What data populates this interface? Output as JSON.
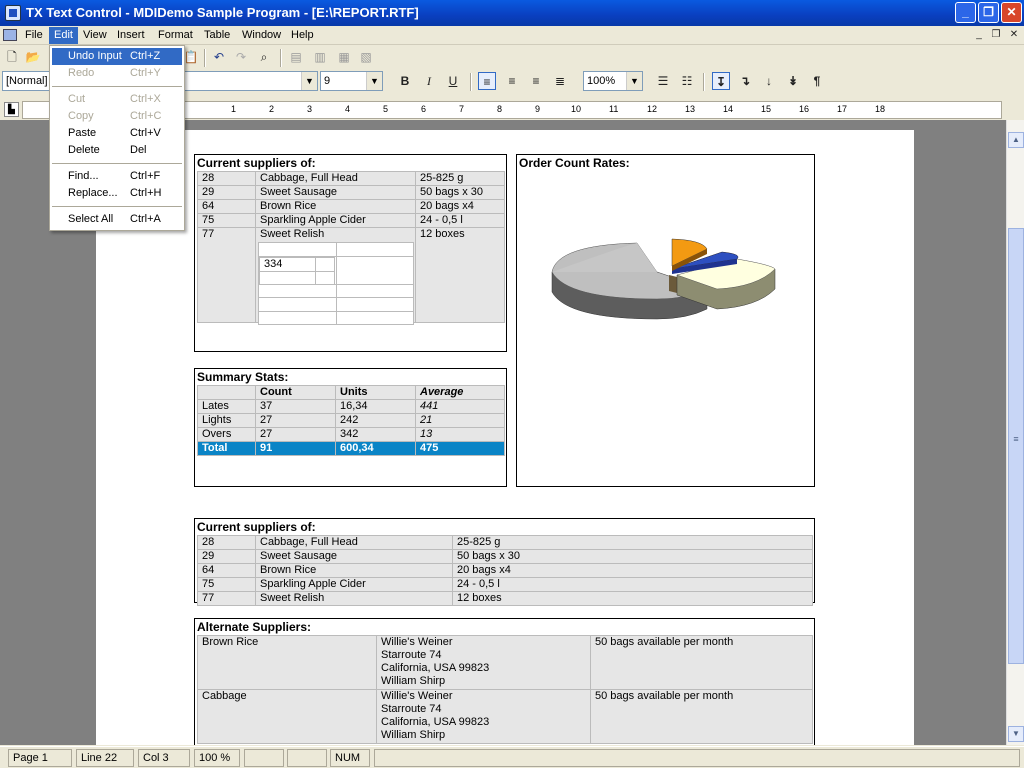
{
  "window": {
    "title": "TX Text Control - MDIDemo Sample Program - [E:\\REPORT.RTF]"
  },
  "menu": [
    "File",
    "Edit",
    "View",
    "Insert",
    "Format",
    "Table",
    "Window",
    "Help"
  ],
  "toolbar": {
    "style": "[Normal]",
    "size": "9",
    "zoom": "100%"
  },
  "ruler": [
    "1",
    "2",
    "3",
    "4",
    "5",
    "6",
    "7",
    "8",
    "9",
    "10",
    "11",
    "12",
    "13",
    "14",
    "15",
    "16",
    "17",
    "18"
  ],
  "edit_menu": [
    {
      "label": "Undo Input",
      "shortcut": "Ctrl+Z",
      "state": "selected"
    },
    {
      "label": "Redo",
      "shortcut": "Ctrl+Y",
      "state": "disabled"
    },
    {
      "label": "Cut",
      "shortcut": "Ctrl+X",
      "state": "disabled"
    },
    {
      "label": "Copy",
      "shortcut": "Ctrl+C",
      "state": "disabled"
    },
    {
      "label": "Paste",
      "shortcut": "Ctrl+V",
      "state": "enabled"
    },
    {
      "label": "Delete",
      "shortcut": "Del",
      "state": "enabled"
    },
    {
      "label": "Find...",
      "shortcut": "Ctrl+F",
      "state": "enabled"
    },
    {
      "label": "Replace...",
      "shortcut": "Ctrl+H",
      "state": "enabled"
    },
    {
      "label": "Select All",
      "shortcut": "Ctrl+A",
      "state": "enabled"
    }
  ],
  "doc": {
    "suppliers1": {
      "caption": "Current suppliers of:",
      "rows": [
        [
          "28",
          "Cabbage, Full Head",
          "25-825 g"
        ],
        [
          "29",
          "Sweet Sausage",
          "50 bags x 30"
        ],
        [
          "64",
          "Brown Rice",
          "20 bags x4"
        ],
        [
          "75",
          "Sparkling Apple Cider",
          "24 - 0,5 l"
        ],
        [
          "77",
          "Sweet Relish",
          "12 boxes"
        ]
      ],
      "nested_value": "334"
    },
    "chart": {
      "caption": "Order Count Rates:"
    },
    "summary": {
      "caption": "Summary Stats:",
      "headers": [
        "",
        "Count",
        "Units",
        "Average"
      ],
      "rows": [
        [
          "Lates",
          "37",
          "16,34",
          "441"
        ],
        [
          "Lights",
          "27",
          "242",
          "21"
        ],
        [
          "Overs",
          "27",
          "342",
          "13"
        ]
      ],
      "total": [
        "Total",
        "91",
        "600,34",
        "475"
      ]
    },
    "suppliers2": {
      "caption": "Current suppliers of:",
      "rows": [
        [
          "28",
          "Cabbage, Full Head",
          "25-825 g"
        ],
        [
          "29",
          "Sweet Sausage",
          "50 bags x 30"
        ],
        [
          "64",
          "Brown Rice",
          "20 bags x4"
        ],
        [
          "75",
          "Sparkling Apple Cider",
          "24 - 0,5 l"
        ],
        [
          "77",
          "Sweet Relish",
          "12 boxes"
        ]
      ]
    },
    "alternate": {
      "caption": "Alternate Suppliers:",
      "rows": [
        {
          "item": "Brown Rice",
          "lines": [
            "Willie's Weiner",
            "Starroute 74",
            "California, USA 99823",
            "William Shirp"
          ],
          "note": "50 bags available per month"
        },
        {
          "item": "Cabbage",
          "lines": [
            "Willie's Weiner",
            "Starroute 74",
            "California, USA 99823",
            "William Shirp"
          ],
          "note": "50 bags available per month"
        }
      ]
    }
  },
  "status": {
    "page": "Page   1",
    "line": "Line  22",
    "col": "Col   3",
    "zoom": "100 %",
    "num": "NUM"
  },
  "colors": {
    "titlebar": "#0a3fbf",
    "selection": "#316ac5",
    "total_row": "#0a84c6",
    "cell": "#e6e6e6"
  }
}
